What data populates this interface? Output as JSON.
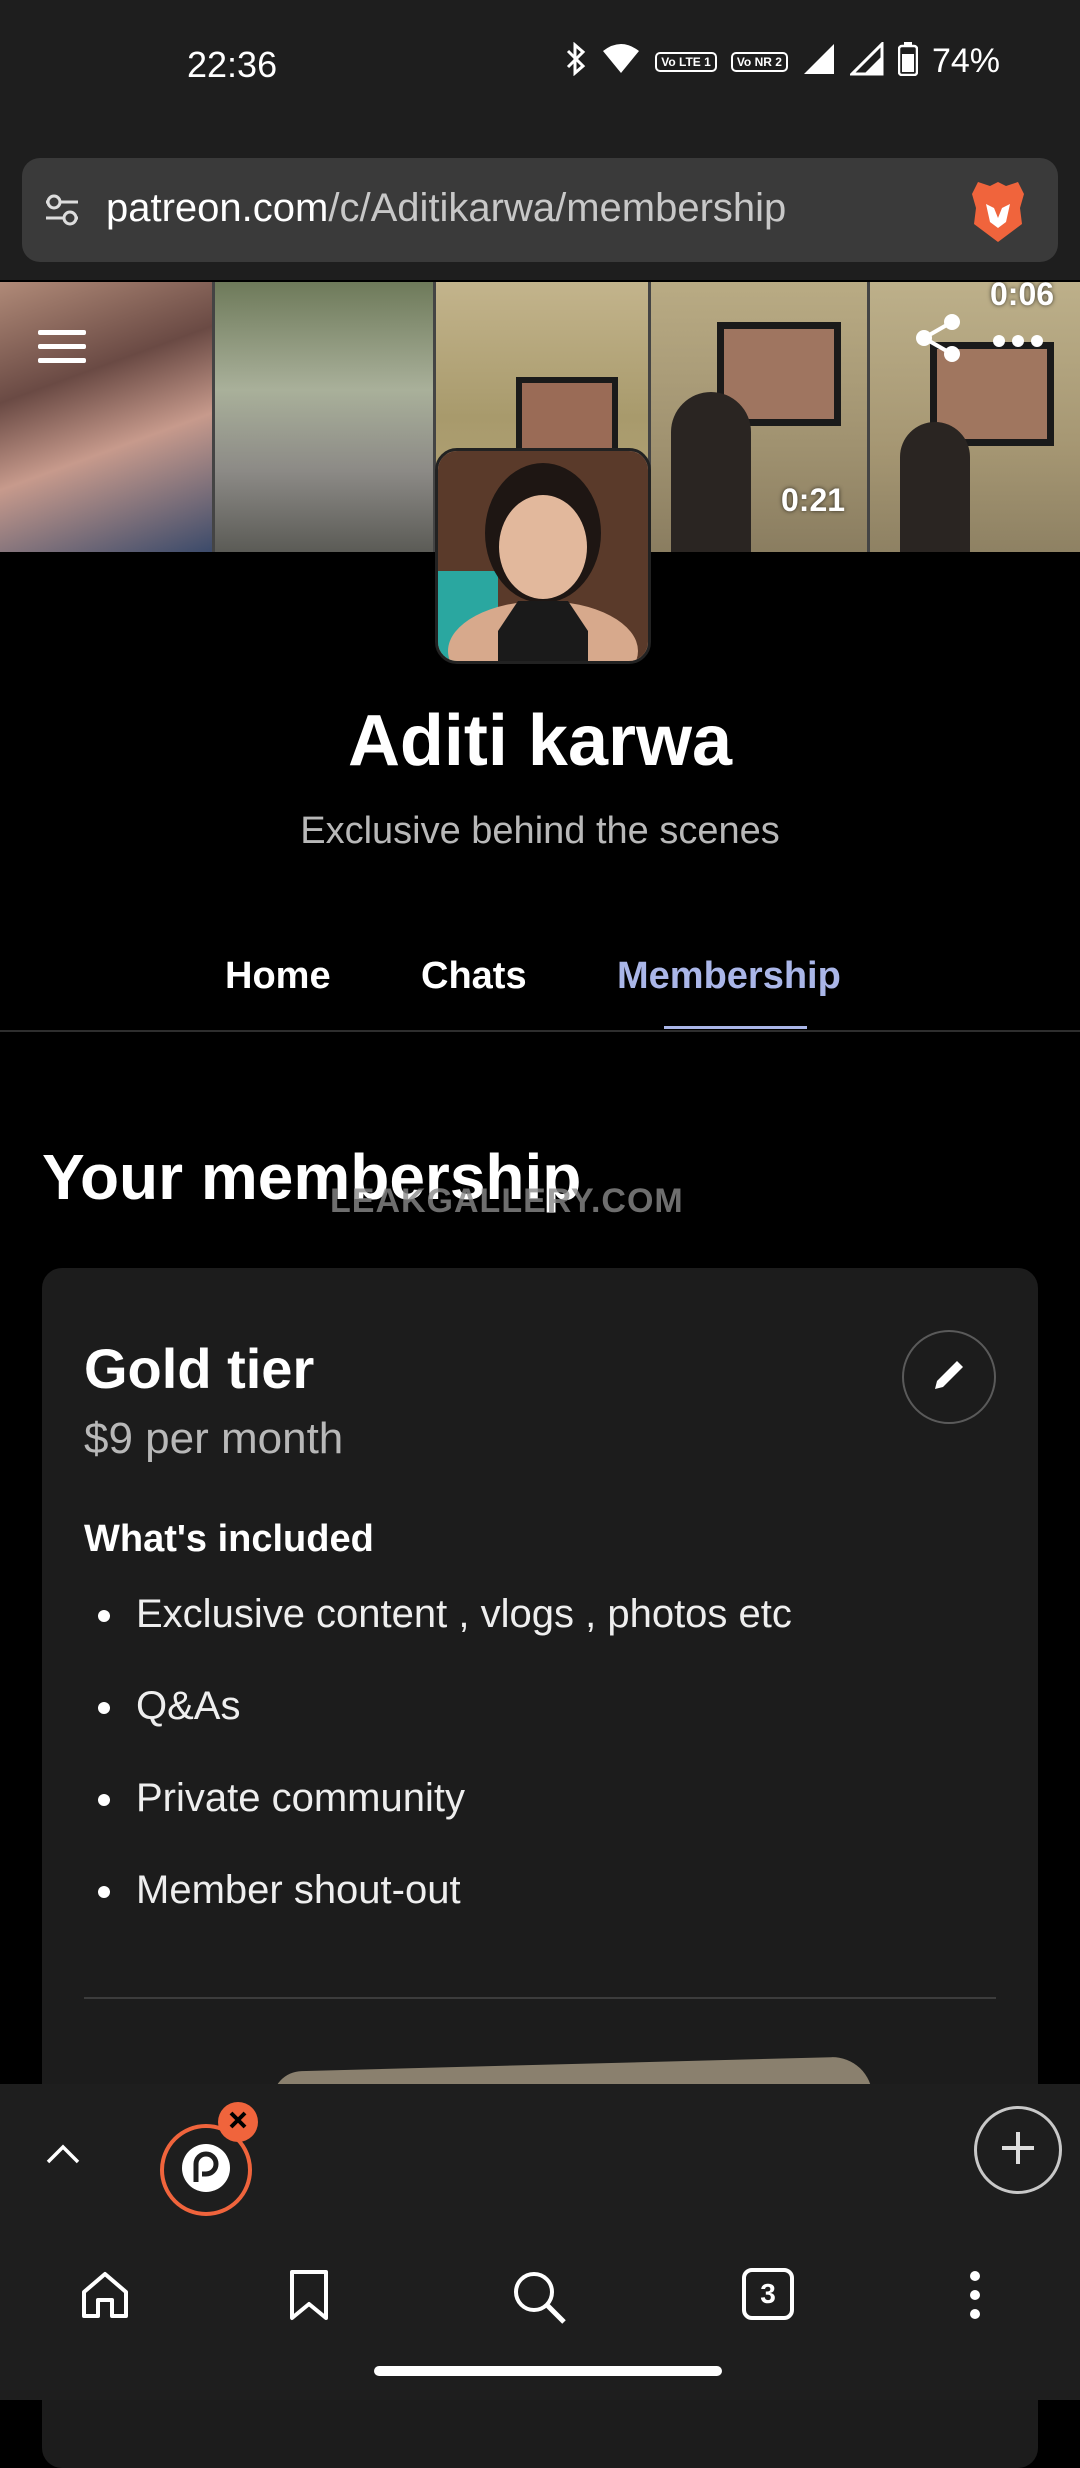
{
  "status_bar": {
    "time": "22:36",
    "badge_1": "Vo LTE 1",
    "badge_2": "Vo NR 2",
    "battery": "74%"
  },
  "url_bar": {
    "host": "patreon.com",
    "path": "/c/Aditikarwa/membership"
  },
  "banner": {
    "video_time_1": "0:21",
    "video_time_2": "0:06"
  },
  "profile": {
    "name": "Aditi karwa",
    "tagline": "Exclusive behind the scenes"
  },
  "tabs": [
    {
      "label": "Home",
      "active": false
    },
    {
      "label": "Chats",
      "active": false
    },
    {
      "label": "Membership",
      "active": true
    }
  ],
  "membership": {
    "section_title": "Your membership",
    "watermark": "LEAKGALLERY.COM",
    "tier_name": "Gold tier",
    "tier_price": "$9 per month",
    "included_heading": "What's included",
    "benefits": [
      "Exclusive content , vlogs , photos etc",
      "Q&As",
      "Private community",
      "Member shout-out"
    ]
  },
  "browser_toolbar": {
    "tab_count": "3"
  },
  "colors": {
    "accent_tab": "#aab6e8",
    "brave_orange": "#f0643c",
    "background": "#000000",
    "card": "#1c1c1c"
  },
  "icons": [
    "bluetooth-icon",
    "wifi-icon",
    "signal-icon",
    "battery-icon",
    "tune-icon",
    "brave-lion-icon",
    "menu-icon",
    "share-icon",
    "more-icon",
    "edit-pencil-icon",
    "chevron-up-icon",
    "patreon-icon",
    "close-icon",
    "plus-icon",
    "home-icon",
    "bookmark-icon",
    "search-icon",
    "tabs-icon",
    "overflow-icon"
  ]
}
